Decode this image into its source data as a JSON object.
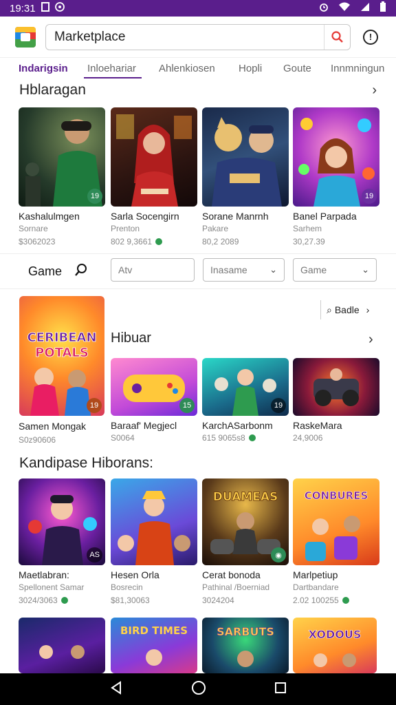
{
  "status": {
    "time": "19:31"
  },
  "search": {
    "value": "Marketplace"
  },
  "tabs": [
    "Indarigsin",
    "Inloehariar",
    "Ahlenkiosen",
    "Hopli",
    "Goute",
    "Innmningun"
  ],
  "sections": {
    "s1": {
      "title": "Hblaragan"
    },
    "s2": {
      "title": "Hibuar"
    },
    "s3": {
      "title": "Kandipase Hiborans:"
    }
  },
  "row1": [
    {
      "title": "Kashalulmgen",
      "sub": "Sornare",
      "price": "$3062023",
      "badge": "19"
    },
    {
      "title": "Sarla Socengirn",
      "sub": "Prenton",
      "price": "802 9,3661",
      "badge": ""
    },
    {
      "title": "Sorane Manrnh",
      "sub": "Pakare",
      "price": "80,2 2089",
      "badge": ""
    },
    {
      "title": "Banel Parpada",
      "sub": "Sarhem",
      "price": "30,27.39",
      "badge": "19"
    }
  ],
  "filters": {
    "label": "Game",
    "field1": "Atv",
    "field2": "Inasame",
    "field3": "Game"
  },
  "featured": {
    "banner_text": "CERIBEAN POTALS",
    "badge": "19",
    "side_link": "Badle"
  },
  "row2": [
    {
      "title": "Baraaf' Megjecl",
      "sub": "S0064",
      "badge": "15"
    },
    {
      "title": "KarchASarbonm",
      "sub": "615 9065s8",
      "badge": "19"
    },
    {
      "title": "RaskeMara",
      "sub": "24,9006",
      "badge": ""
    }
  ],
  "featured_card": {
    "title": "Samen Mongak",
    "sub": "S0z90606"
  },
  "row3": [
    {
      "title": "Maetlabran:",
      "sub": "Spellonent Samar",
      "price": "3024/3063",
      "badge": "AS"
    },
    {
      "title": "Hesen Orla",
      "sub": "Bosrecin",
      "price": "$81,30063",
      "badge": ""
    },
    {
      "title": "Cerat bonoda",
      "sub": "Pathinal /Boerniad",
      "price": "3024204",
      "badge": ""
    },
    {
      "title": "Marlpetiup",
      "sub": "Dartbandare",
      "price": "2.02 100255",
      "badge": ""
    }
  ],
  "row4_banners": [
    "BIRD TIMES",
    "SARBUTS",
    "XODOUS"
  ],
  "colors": {
    "accent": "#5a1e8c",
    "status_bar": "#5a1e8c"
  }
}
